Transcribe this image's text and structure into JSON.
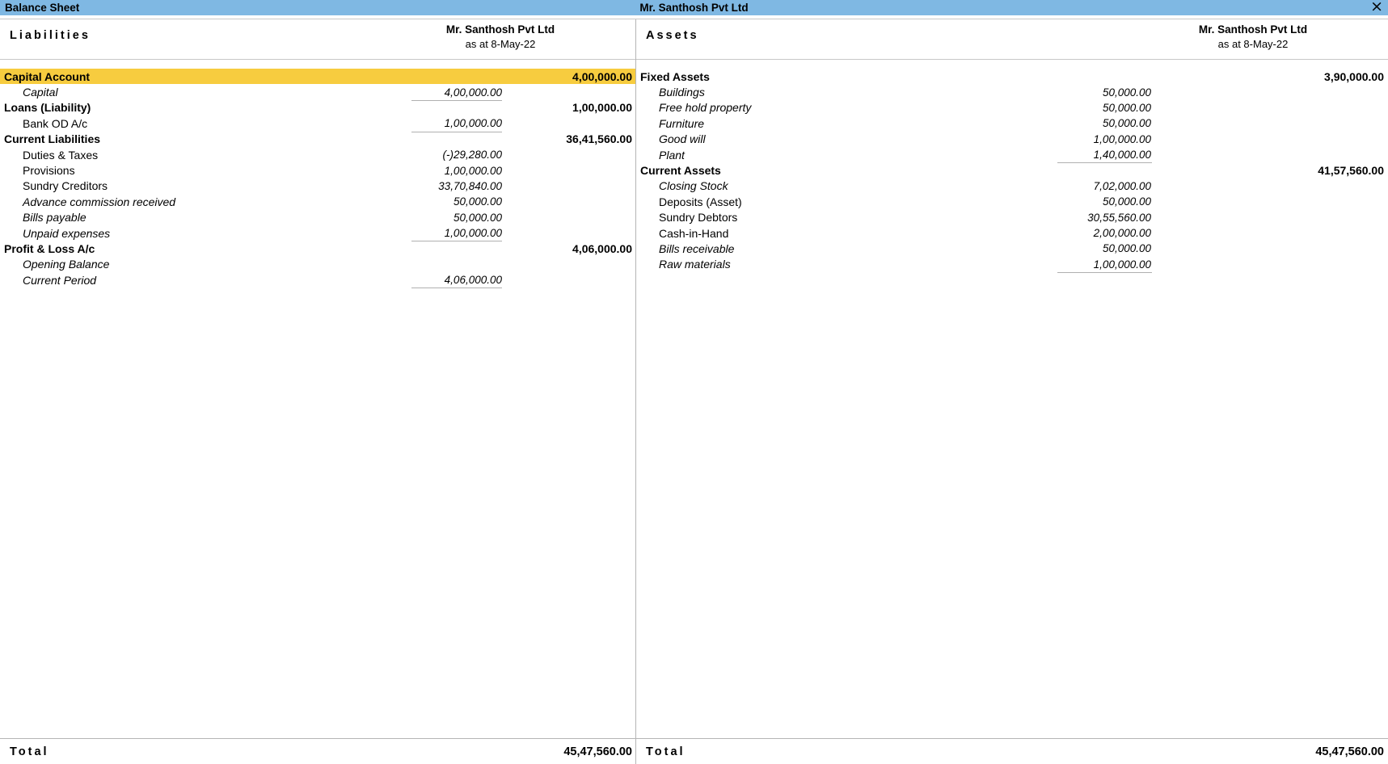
{
  "titlebar": {
    "left_title": "Balance Sheet",
    "center_title": "Mr. Santhosh Pvt Ltd",
    "close_icon": "×"
  },
  "liabilities": {
    "heading": "Liabilities",
    "company": "Mr. Santhosh Pvt Ltd",
    "as_at": "as at 8-May-22",
    "groups": [
      {
        "name": "Capital Account",
        "total": "4,00,000.00",
        "highlight": true,
        "items": [
          {
            "label": "Capital",
            "amount": "4,00,000.00",
            "italic": true
          }
        ]
      },
      {
        "name": "Loans (Liability)",
        "total": "1,00,000.00",
        "highlight": false,
        "items": [
          {
            "label": "Bank OD A/c",
            "amount": "1,00,000.00",
            "italic": false
          }
        ]
      },
      {
        "name": "Current Liabilities",
        "total": "36,41,560.00",
        "highlight": false,
        "items": [
          {
            "label": "Duties & Taxes",
            "amount": "(-)29,280.00",
            "italic": false
          },
          {
            "label": "Provisions",
            "amount": "1,00,000.00",
            "italic": false
          },
          {
            "label": "Sundry Creditors",
            "amount": "33,70,840.00",
            "italic": false
          },
          {
            "label": "Advance commission received",
            "amount": "50,000.00",
            "italic": true
          },
          {
            "label": "Bills payable",
            "amount": "50,000.00",
            "italic": true
          },
          {
            "label": "Unpaid expenses",
            "amount": "1,00,000.00",
            "italic": true
          }
        ]
      },
      {
        "name": "Profit & Loss A/c",
        "total": "4,06,000.00",
        "highlight": false,
        "items": [
          {
            "label": "Opening Balance",
            "amount": "",
            "italic": true
          },
          {
            "label": "Current Period",
            "amount": "4,06,000.00",
            "italic": true
          }
        ]
      }
    ],
    "total_label": "Total",
    "total_amount": "45,47,560.00"
  },
  "assets": {
    "heading": "Assets",
    "company": "Mr. Santhosh Pvt Ltd",
    "as_at": "as at 8-May-22",
    "groups": [
      {
        "name": "Fixed Assets",
        "total": "3,90,000.00",
        "highlight": false,
        "items": [
          {
            "label": "Buildings",
            "amount": "50,000.00",
            "italic": true
          },
          {
            "label": "Free hold property",
            "amount": "50,000.00",
            "italic": true
          },
          {
            "label": "Furniture",
            "amount": "50,000.00",
            "italic": true
          },
          {
            "label": "Good will",
            "amount": "1,00,000.00",
            "italic": true
          },
          {
            "label": "Plant",
            "amount": "1,40,000.00",
            "italic": true
          }
        ]
      },
      {
        "name": "Current Assets",
        "total": "41,57,560.00",
        "highlight": false,
        "items": [
          {
            "label": "Closing Stock",
            "amount": "7,02,000.00",
            "italic": true
          },
          {
            "label": "Deposits (Asset)",
            "amount": "50,000.00",
            "italic": false
          },
          {
            "label": "Sundry Debtors",
            "amount": "30,55,560.00",
            "italic": false
          },
          {
            "label": "Cash-in-Hand",
            "amount": "2,00,000.00",
            "italic": false
          },
          {
            "label": "Bills receivable",
            "amount": "50,000.00",
            "italic": true
          },
          {
            "label": "Raw materials",
            "amount": "1,00,000.00",
            "italic": true
          }
        ]
      }
    ],
    "total_label": "Total",
    "total_amount": "45,47,560.00"
  },
  "colors": {
    "titlebar": "#7fb8e3",
    "highlight": "#f7cc3f",
    "rule": "#b0b0b0"
  }
}
